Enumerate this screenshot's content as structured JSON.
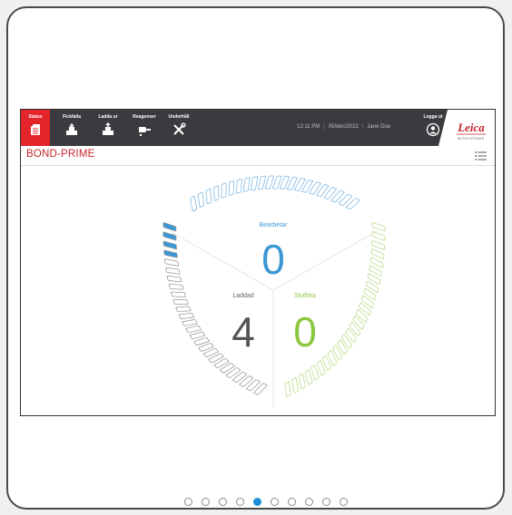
{
  "app": {
    "nav": [
      {
        "id": "status",
        "label": "Status",
        "icon": "slide-rack-icon",
        "active": true
      },
      {
        "id": "fickfalla",
        "label": "Fickfalla",
        "icon": "load-tray-icon",
        "active": false
      },
      {
        "id": "ladda-ur",
        "label": "Ladda ur",
        "icon": "unload-tray-icon",
        "active": false
      },
      {
        "id": "reagenser",
        "label": "Reagenser",
        "icon": "reagent-dropper-icon",
        "active": false
      },
      {
        "id": "underhall",
        "label": "Underhåll",
        "icon": "maintenance-tools-icon",
        "active": false
      }
    ],
    "status_bar": {
      "time": "12:11 PM",
      "date": "05/dec/2022",
      "user": "Jane Doe"
    },
    "logout_label": "Logga ut",
    "logo": {
      "brand": "Leica",
      "sub": "BIOSYSTEMS"
    },
    "page_title": "BOND-PRIME",
    "colors": {
      "accent_red": "#e3242b",
      "processing_blue": "#3a97d4",
      "loaded_gray": "#666666",
      "complete_green": "#8dc63f"
    }
  },
  "wheel": {
    "processing": {
      "label": "Bearbetar",
      "count": "0"
    },
    "loaded": {
      "label": "Laddad",
      "count": "4"
    },
    "complete": {
      "label": "Slutföra",
      "count": "0"
    },
    "loaded_filled_slots": 4
  },
  "pagination": {
    "total": 10,
    "current": 5
  }
}
